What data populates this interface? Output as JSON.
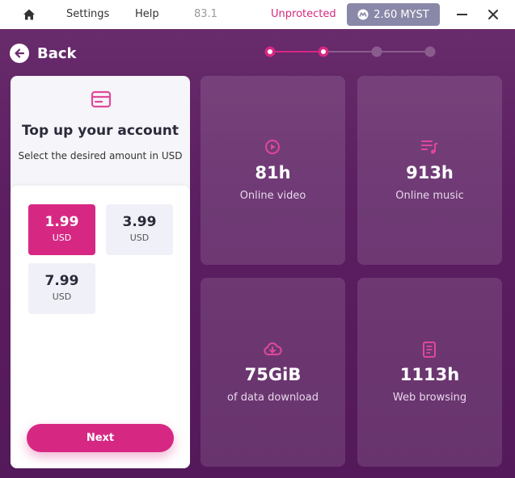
{
  "titlebar": {
    "settings": "Settings",
    "help": "Help",
    "ip": "83.1",
    "status": "Unprotected",
    "balance": "2.60 MYST",
    "icons": [
      "home-icon",
      "myst-logo-icon",
      "minimize-icon",
      "close-icon"
    ]
  },
  "nav": {
    "back_label": "Back",
    "stepper": {
      "total_steps": 4,
      "current_step": 2
    }
  },
  "topup": {
    "title": "Top up your account",
    "subtitle": "Select the desired amount in USD",
    "amounts": [
      {
        "value": "1.99",
        "currency": "USD",
        "selected": true
      },
      {
        "value": "3.99",
        "currency": "USD",
        "selected": false
      },
      {
        "value": "7.99",
        "currency": "USD",
        "selected": false
      }
    ],
    "next_label": "Next"
  },
  "stats": [
    {
      "icon": "play-circle-icon",
      "value": "81h",
      "label": "Online video"
    },
    {
      "icon": "music-list-icon",
      "value": "913h",
      "label": "Online music"
    },
    {
      "icon": "cloud-download-icon",
      "value": "75GiB",
      "label": "of data download"
    },
    {
      "icon": "document-icon",
      "value": "1113h",
      "label": "Web browsing"
    }
  ],
  "colors": {
    "accent": "#d62883",
    "background": "#5c1f62",
    "balance_badge": "#8a88a8",
    "status_unprotected": "#d6287e"
  }
}
